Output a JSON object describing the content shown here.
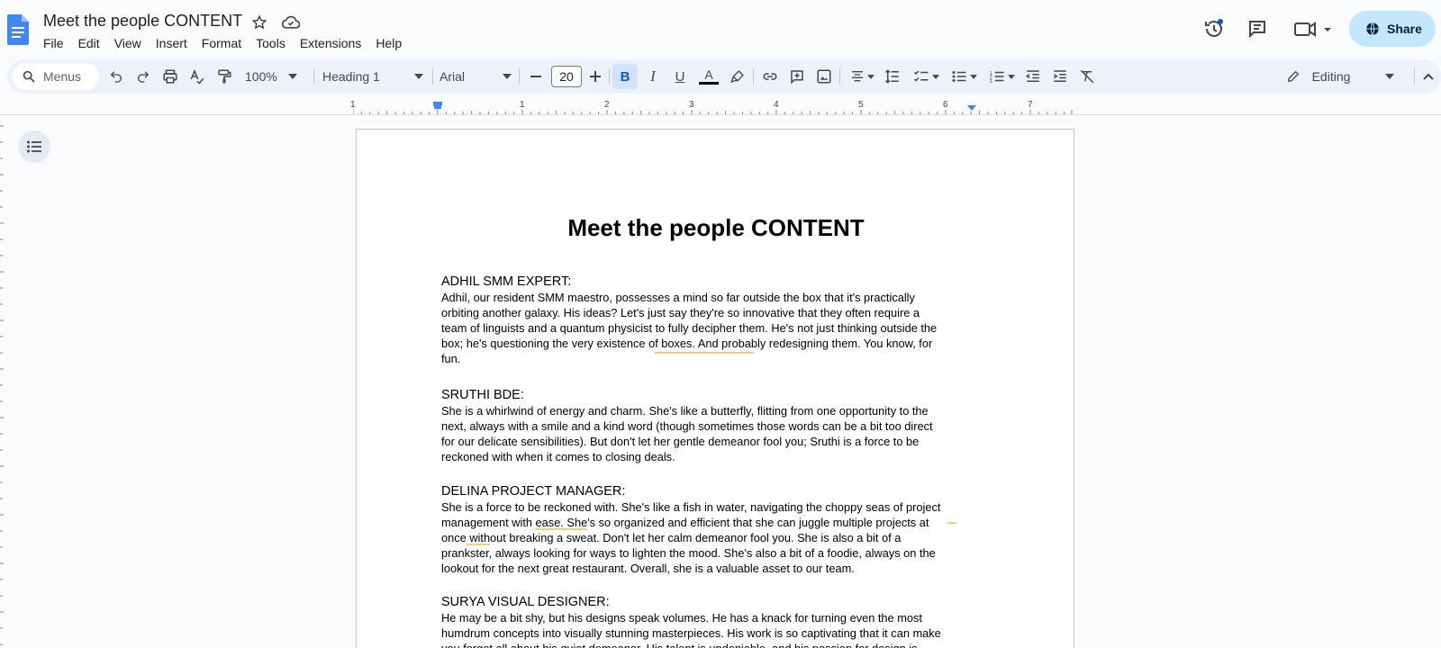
{
  "app": {
    "doc_title": "Meet the people CONTENT",
    "menus": [
      "File",
      "Edit",
      "View",
      "Insert",
      "Format",
      "Tools",
      "Extensions",
      "Help"
    ],
    "share_label": "Share"
  },
  "toolbar": {
    "search_label": "Menus",
    "zoom": "100%",
    "style": "Heading 1",
    "font": "Arial",
    "font_size": "20",
    "mode_label": "Editing"
  },
  "ruler": {
    "labels": [
      "1",
      "1",
      "2",
      "3",
      "4",
      "5",
      "6",
      "7"
    ]
  },
  "document": {
    "heading": "Meet the people CONTENT",
    "sections": [
      {
        "title": "ADHIL SMM EXPERT:",
        "lines": [
          "Adhil, our resident SMM maestro, possesses a mind so far outside the box that it's practically",
          "orbiting another galaxy. His ideas? Let's just say they're so innovative that they often require a",
          "team of linguists and a quantum physicist to fully decipher them. He's not just thinking outside the",
          "box; he's questioning the very existence of boxes. And probably redesigning them. You know, for",
          "fun."
        ]
      },
      {
        "title": "SRUTHI BDE:",
        "lines": [
          "She is a whirlwind of energy and charm. She's like a butterfly, flitting from one opportunity to the",
          "next, always with a smile and a kind word (though sometimes those words can be a bit too direct",
          "for our delicate sensibilities). But don't let her gentle demeanor fool you; Sruthi is a force to be",
          "reckoned with when it comes to closing deals."
        ]
      },
      {
        "title": "DELINA PROJECT MANAGER:",
        "lines": [
          "She is a force to be reckoned with. She's like a fish in water, navigating the choppy seas of project",
          "management with ease. She's so organized and efficient that she can juggle multiple projects at",
          "once without breaking a sweat. Don't let her calm demeanor fool you. She is also a bit of a",
          "prankster, always looking for ways to lighten the mood. She's also a bit of a foodie, always on the",
          "lookout for the next great restaurant. Overall, she is a valuable asset to our team."
        ]
      },
      {
        "title": "SURYA VISUAL DESIGNER:",
        "lines": [
          "He may be a bit shy, but his designs speak volumes. He has a knack for turning even the most",
          "humdrum concepts into visually stunning masterpieces. His work is so captivating that it can make",
          "you forget all about his quiet demeanor. His talent is undeniable, and his passion for design is"
        ]
      }
    ]
  }
}
